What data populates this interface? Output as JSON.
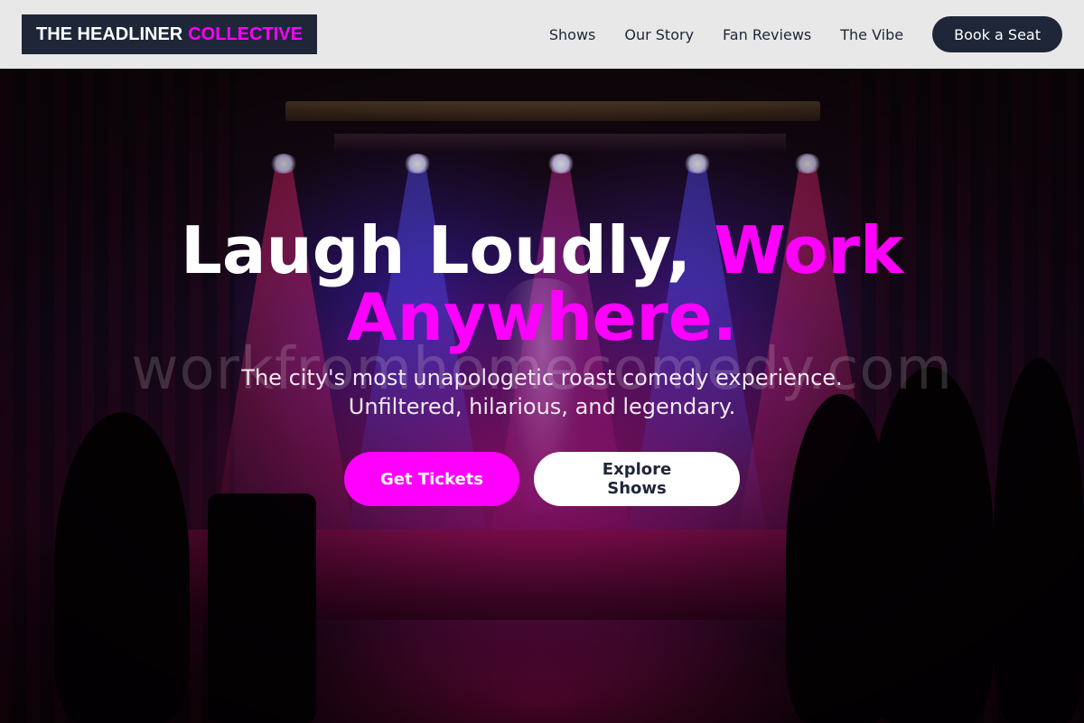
{
  "nav": {
    "logo_main": "THE HEADLINER",
    "logo_accent": "COLLECTIVE",
    "links": [
      "Shows",
      "Our Story",
      "Fan Reviews",
      "The Vibe"
    ],
    "cta_label": "Book a Seat"
  },
  "hero": {
    "headline_main": "Laugh Loudly,",
    "headline_accent": "Work Anywhere.",
    "subtitle_line1": "The city's most unapologetic roast comedy experience.",
    "subtitle_line2": "Unfiltered, hilarious, and legendary.",
    "primary_button": "Get Tickets",
    "secondary_button": "Explore Shows",
    "watermark": "workfromhomecomedy.com"
  },
  "colors": {
    "accent": "#ff00ff",
    "navy": "#1e2638",
    "nav_background": "#e8e8e8"
  }
}
